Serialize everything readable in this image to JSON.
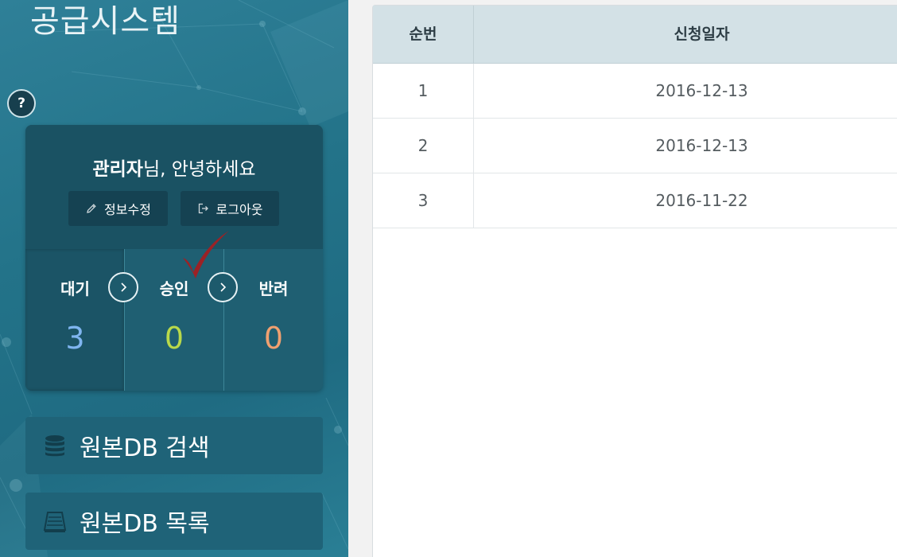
{
  "app": {
    "title": "공급시스템"
  },
  "help": {
    "label": "?"
  },
  "user_card": {
    "user_name": "관리자",
    "greeting_suffix": "님, 안녕하세요",
    "edit_info_label": "정보수정",
    "logout_label": "로그아웃"
  },
  "status": [
    {
      "label": "대기",
      "count": "3",
      "color": "#7fb5f0"
    },
    {
      "label": "승인",
      "count": "0",
      "color": "#b9d94a"
    },
    {
      "label": "반려",
      "count": "0",
      "color": "#f0a070"
    }
  ],
  "menu": [
    {
      "label": "원본DB 검색",
      "icon": "database-icon"
    },
    {
      "label": "원본DB 목록",
      "icon": "list-box-icon"
    }
  ],
  "table": {
    "columns": [
      "순번",
      "신청일자"
    ],
    "rows": [
      {
        "no": "1",
        "date": "2016-12-13"
      },
      {
        "no": "2",
        "date": "2016-12-13"
      },
      {
        "no": "3",
        "date": "2016-11-22"
      }
    ]
  },
  "colors": {
    "sidebar": "#237389",
    "card": "#1a5263",
    "table_header": "#d3e1e6",
    "checkmark": "#9b2226"
  }
}
